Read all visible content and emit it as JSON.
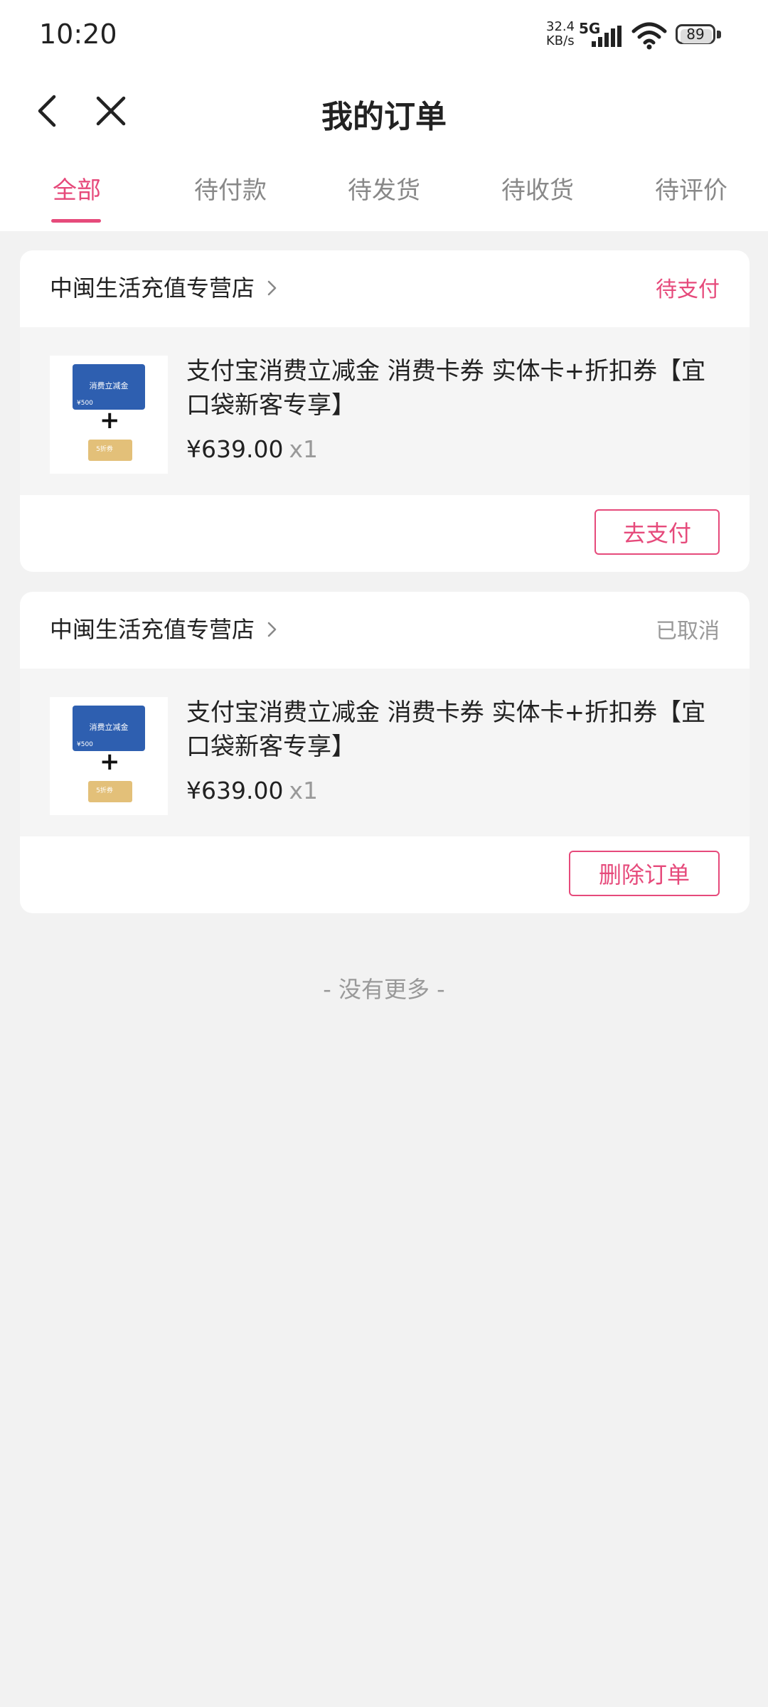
{
  "status_bar": {
    "time": "10:20",
    "net_speed_value": "32.4",
    "net_speed_unit": "KB/s",
    "network_type": "5G",
    "battery": "89"
  },
  "nav": {
    "title": "我的订单",
    "back_icon": "chevron-left-icon",
    "close_icon": "close-icon"
  },
  "tabs": [
    {
      "label": "全部",
      "active": true
    },
    {
      "label": "待付款",
      "active": false
    },
    {
      "label": "待发货",
      "active": false
    },
    {
      "label": "待收货",
      "active": false
    },
    {
      "label": "待评价",
      "active": false
    }
  ],
  "orders": [
    {
      "store": "中闽生活充值专营店",
      "status": "待支付",
      "product_title": "支付宝消费立减金 消费卡券 实体卡+折扣券【宜口袋新客专享】",
      "price": "¥639.00",
      "qty": "x1",
      "thumb_card_text": "消费立减金",
      "thumb_card_value": "¥500",
      "thumb_coupon_text": "5折券",
      "action": "去支付"
    },
    {
      "store": "中闽生活充值专营店",
      "status": "已取消",
      "product_title": "支付宝消费立减金 消费卡券 实体卡+折扣券【宜口袋新客专享】",
      "price": "¥639.00",
      "qty": "x1",
      "thumb_card_text": "消费立减金",
      "thumb_card_value": "¥500",
      "thumb_coupon_text": "5折券",
      "action": "删除订单"
    }
  ],
  "footer": {
    "no_more": "- 没有更多 -"
  },
  "colors": {
    "accent": "#e64a7b",
    "background": "#f2f2f2",
    "muted": "#999999"
  }
}
